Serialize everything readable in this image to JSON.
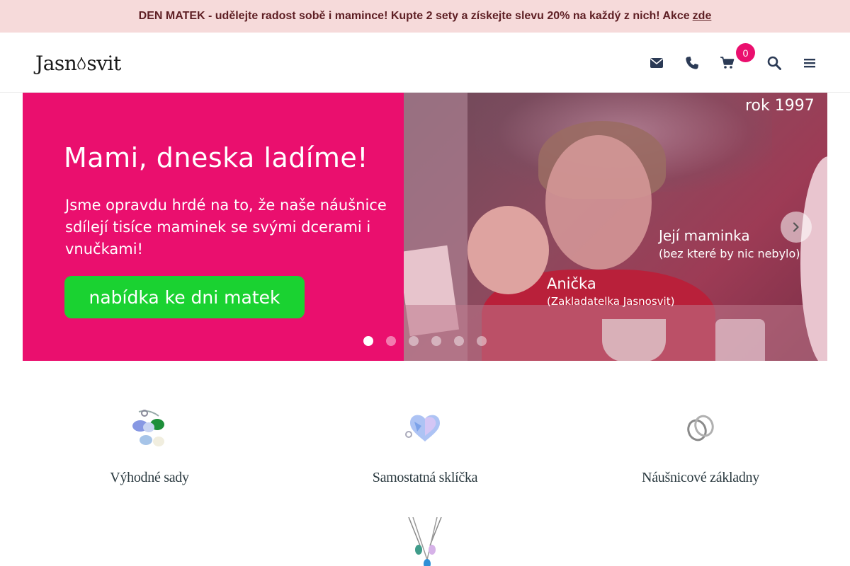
{
  "promo": {
    "text": "DEN MATEK - udělejte radost sobě i mamince! Kupte 2 sety a získejte slevu 20% na každý z nich! Akce",
    "link": "zde"
  },
  "header": {
    "logo_left": "Jasn",
    "logo_right": "svit",
    "cart_count": "0",
    "icons": [
      "envelope-icon",
      "phone-icon",
      "cart-icon",
      "search-icon",
      "menu-icon"
    ]
  },
  "hero": {
    "title": "Mami, dneska ladíme!",
    "text": "Jsme opravdu hrdé na to, že naše náušnice sdílejí tisíce maminek se svými dcerami i vnučkami!",
    "cta": "nabídka ke dni matek",
    "year": "rok 1997",
    "mom": "Její maminka",
    "mom_sub": "(bez které by nic nebylo)",
    "founder": "Anička",
    "founder_sub": "(Zakladatelka Jasnosvit)",
    "slides": 6,
    "active_slide": 1
  },
  "categories": [
    {
      "label": "Výhodné sady"
    },
    {
      "label": "Samostatná sklíčka"
    },
    {
      "label": "Náušnicové základny"
    },
    {
      "label": ""
    }
  ],
  "colors": {
    "promo_bg": "#f6dada",
    "promo_text": "#5e1f24",
    "brand_pink": "#ea0f6e",
    "cta_green": "#1ad231"
  }
}
